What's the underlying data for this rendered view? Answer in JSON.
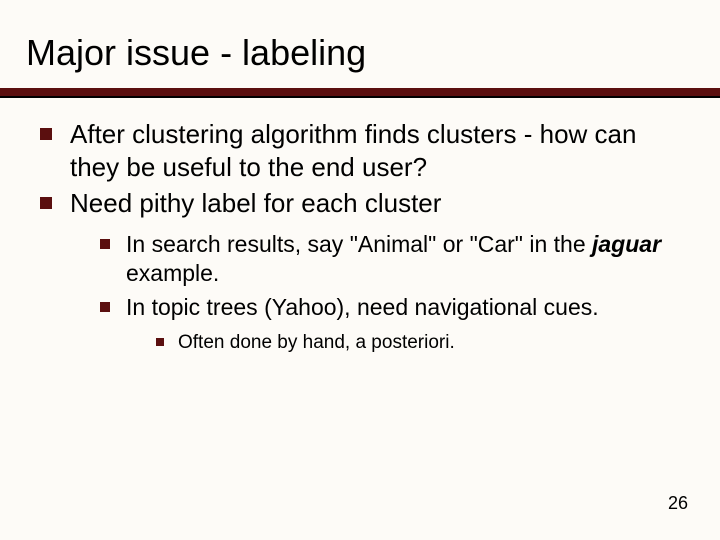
{
  "title": "Major issue - labeling",
  "bullets": {
    "b1": "After clustering algorithm finds clusters - how can they be useful to the end user?",
    "b2": "Need pithy label for each cluster",
    "b2_1_pre": "In search results, say \"Animal\" or \"Car\" in the ",
    "b2_1_em": "jaguar",
    "b2_1_post": " example.",
    "b2_2": "In topic trees (Yahoo), need navigational cues.",
    "b2_2_1": "Often done by hand, a posteriori."
  },
  "page_number": "26"
}
